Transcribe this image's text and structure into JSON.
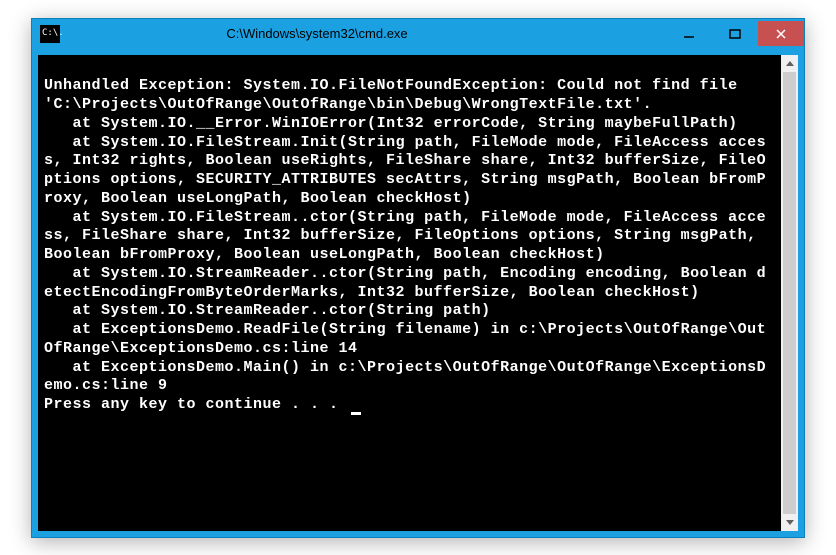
{
  "window": {
    "title": "C:\\Windows\\system32\\cmd.exe",
    "icon_text": "C:\\."
  },
  "console": {
    "lines": [
      "",
      "Unhandled Exception: System.IO.FileNotFoundException: Could not find file 'C:\\Projects\\OutOfRange\\OutOfRange\\bin\\Debug\\WrongTextFile.txt'.",
      "   at System.IO.__Error.WinIOError(Int32 errorCode, String maybeFullPath)",
      "   at System.IO.FileStream.Init(String path, FileMode mode, FileAccess access, Int32 rights, Boolean useRights, FileShare share, Int32 bufferSize, FileOptions options, SECURITY_ATTRIBUTES secAttrs, String msgPath, Boolean bFromProxy, Boolean useLongPath, Boolean checkHost)",
      "   at System.IO.FileStream..ctor(String path, FileMode mode, FileAccess access, FileShare share, Int32 bufferSize, FileOptions options, String msgPath, Boolean bFromProxy, Boolean useLongPath, Boolean checkHost)",
      "   at System.IO.StreamReader..ctor(String path, Encoding encoding, Boolean detectEncodingFromByteOrderMarks, Int32 bufferSize, Boolean checkHost)",
      "   at System.IO.StreamReader..ctor(String path)",
      "   at ExceptionsDemo.ReadFile(String filename) in c:\\Projects\\OutOfRange\\OutOfRange\\ExceptionsDemo.cs:line 14",
      "   at ExceptionsDemo.Main() in c:\\Projects\\OutOfRange\\OutOfRange\\ExceptionsDemo.cs:line 9",
      "Press any key to continue . . . "
    ]
  }
}
